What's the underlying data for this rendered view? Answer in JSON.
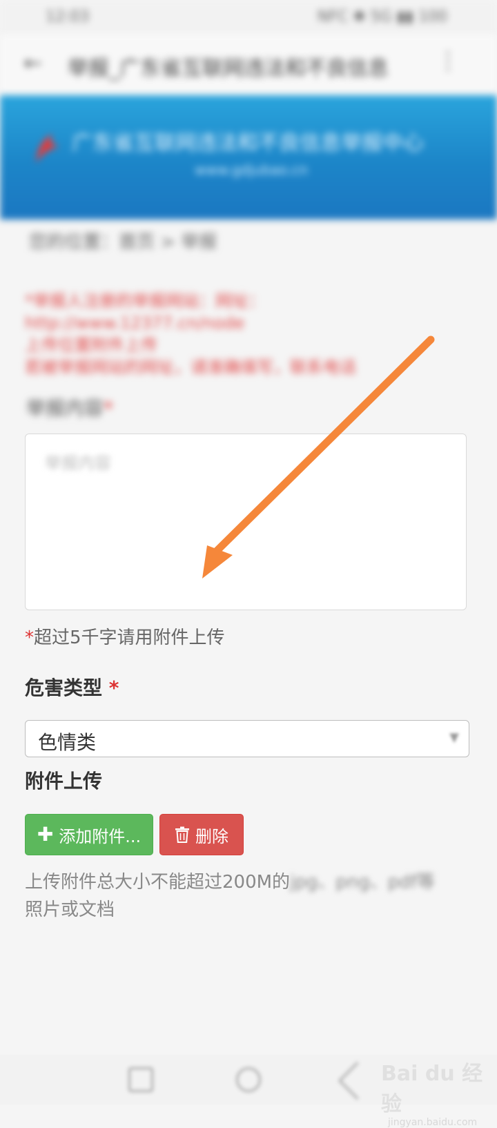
{
  "status_bar": {
    "time": "12:03",
    "right_icons": "NFC ✱ 5G ▮▮ 100"
  },
  "app_bar": {
    "title": "举报_广东省互联网违法和不良信息",
    "back_icon": "back-arrow-icon",
    "more_icon": "more-vert-icon"
  },
  "banner": {
    "title": "广东省互联网违法和不良信息举报中心",
    "url": "www.gdjubao.cn",
    "colors": {
      "top": "#2aa4dc",
      "bottom": "#1b77c1"
    }
  },
  "breadcrumb": "您的位置：首页 > 举报",
  "notice": {
    "line1": "*举报人注册的举报网站：网址：http://www.12377.cn/node",
    "line2": "上传位置附件上传",
    "line3": "若被举报网站的网址，请准确填写，联系电话"
  },
  "form": {
    "content_label": "举报内容",
    "content_placeholder": "举报内容",
    "hint": "超过5千字请用附件上传",
    "hazard_label": "危害类型",
    "hazard_value": "色情类",
    "attachment_label": "附件上传",
    "add_button": "添加附件...",
    "delete_button": "删除",
    "upload_note_line1": "上传附件总大小不能超过200M的",
    "upload_note_blurred": "jpg、png、pdf等",
    "upload_note_line2": "照片或文档",
    "required_mark": "*"
  },
  "watermark": {
    "brand": "Bai du 经验",
    "url": "jingyan.baidu.com"
  },
  "colors": {
    "accent_green": "#5cb85c",
    "accent_red": "#d9534f",
    "arrow": "#f5873a",
    "notice_red": "#e14b4b"
  }
}
